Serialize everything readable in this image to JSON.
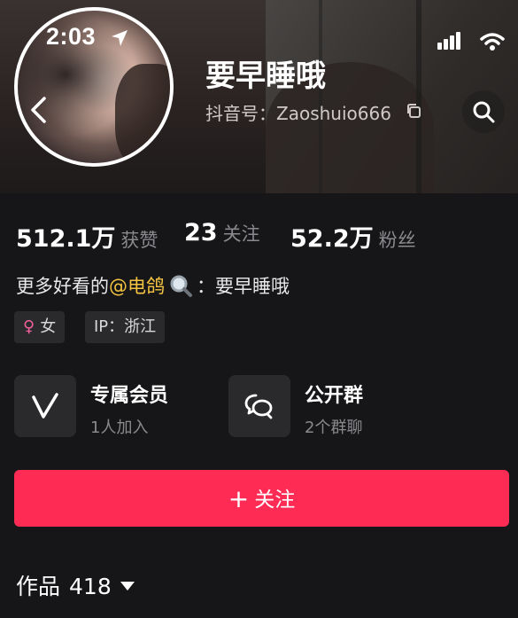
{
  "status_bar": {
    "time": "2:03"
  },
  "profile": {
    "name": "要早睡哦",
    "douyin_id": "抖音号：Zaoshuio666"
  },
  "stats": [
    {
      "value": "512.1万",
      "label": "获赞"
    },
    {
      "value": "23",
      "label": "关注"
    },
    {
      "value": "52.2万",
      "label": "粉丝"
    }
  ],
  "bio": {
    "prefix": "更多好看的",
    "mention": "@电鸽",
    "suffix": "：要早睡哦"
  },
  "tags": {
    "gender": "女",
    "ip": "IP：浙江"
  },
  "cards": [
    {
      "title": "专属会员",
      "subtitle": "1人加入",
      "icon": "v-member-icon"
    },
    {
      "title": "公开群",
      "subtitle": "2个群聊",
      "icon": "chat-bubbles-icon"
    }
  ],
  "follow_button": {
    "plus": "+",
    "label": "关注"
  },
  "works": {
    "label": "作品",
    "count": "418"
  },
  "colors": {
    "accent": "#fe2c55",
    "mention": "#f5c542",
    "background": "#161618",
    "tag_bg": "#2a2a2d",
    "female_icon": "#f0609a"
  }
}
